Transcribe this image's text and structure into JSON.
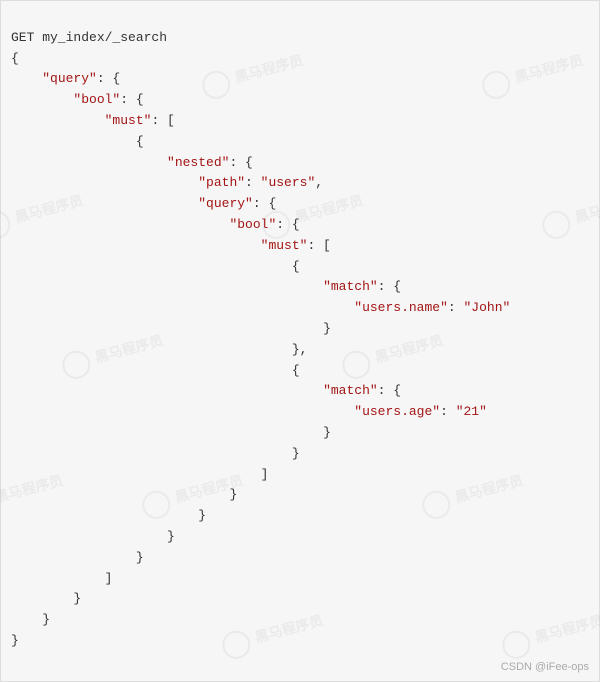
{
  "code": {
    "line1": "GET my_index/_search",
    "line2": "{",
    "line3_key": "\"query\"",
    "line3_rest": ": {",
    "line4_key": "\"bool\"",
    "line4_rest": ": {",
    "line5_key": "\"must\"",
    "line5_rest": ": [",
    "line6": "{",
    "line7_key": "\"nested\"",
    "line7_rest": ": {",
    "line8_key": "\"path\"",
    "line8_mid": ": ",
    "line8_val": "\"users\"",
    "line8_end": ",",
    "line9_key": "\"query\"",
    "line9_rest": ": {",
    "line10_key": "\"bool\"",
    "line10_rest": ": {",
    "line11_key": "\"must\"",
    "line11_rest": ": [",
    "line12": "{",
    "line13_key": "\"match\"",
    "line13_rest": ": {",
    "line14_key": "\"users.name\"",
    "line14_mid": ": ",
    "line14_val": "\"John\"",
    "line15": "}",
    "line16": "},",
    "line17": "{",
    "line18_key": "\"match\"",
    "line18_rest": ": {",
    "line19_key": "\"users.age\"",
    "line19_mid": ": ",
    "line19_val": "\"21\"",
    "line20": "}",
    "line21": "}",
    "line22": "]",
    "line23": "}",
    "line24": "}",
    "line25": "}",
    "line26": "}",
    "line27": "]",
    "line28": "}",
    "line29": "}",
    "line30": "}"
  },
  "watermark_text": "黑马程序员",
  "footer": "CSDN @iFee-ops"
}
